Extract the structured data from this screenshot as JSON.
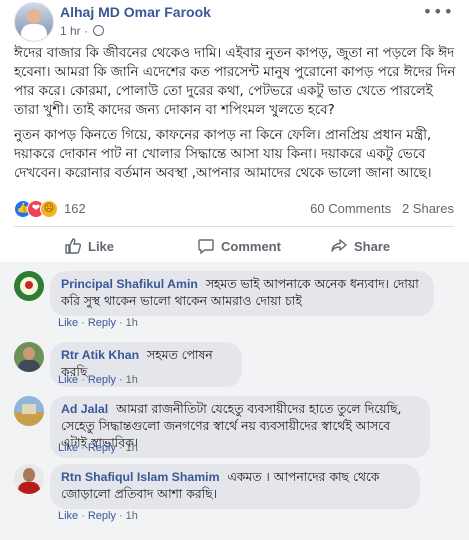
{
  "post": {
    "author": "Alhaj MD Omar Farook",
    "time": "1 hr",
    "paragraphs": [
      "ঈদের বাজার কি জীবনের থেকেও দামি। এইবার নুতন কাপড়, জুতা না পড়লে কি ঈদ হবেনা। আমরা কি জানি এদেশের কত পারসেন্ট মানুষ পুরোনো কাপড় পরে ঈদের দিন পার করে। কোরমা, পোলাউ তো দুরের কথা, পেটভরে একটু ভাত খেতে পারলেই তারা খুশী। তাই কাদের জন্য দোকান বা শপিংমল খুলতে হবে?",
      "নুতন কাপড় কিনতে গিয়ে, কাফনের কাপড় না কিনে ফেলি। প্রানপ্রিয় প্রধান মন্ত্রী, দয়াকরে দোকান পাট না খোলার সিদ্ধান্তে আসা যায় কিনা। দয়াকরে একটু ভেবে দেখবেন। করোনার বর্তমান অবস্থা ,আপনার আমাদের থেকে ভালো জানা আছে।"
    ],
    "reaction_count": "162",
    "comments_count": "60 Comments",
    "shares_count": "2 Shares"
  },
  "actions": {
    "like": "Like",
    "comment": "Comment",
    "share": "Share"
  },
  "comment_actions": {
    "like": "Like",
    "reply": "Reply",
    "dot": "·"
  },
  "comments": [
    {
      "name": "Principal Shafikul Amin",
      "text": "সহমত ভাই আপনাকে অনেক ধন্যবাদ। দোয়া করি সুস্থ থাকেন ভালো থাকেন আমরাও দোয়া চাই",
      "time": "1h"
    },
    {
      "name": "Rtr Atik Khan",
      "text": "সহমত পোষন করছি",
      "time": "1h"
    },
    {
      "name": "Ad Jalal",
      "text": "আমরা রাজনীতিটা যেহেতু ব্যবসায়ীদের হাতে তুলে দিয়েছি, সেহেতু সিদ্ধান্তগুলো জনগণের স্বার্থে নয় ব্যবসায়ীদের স্বার্থেই আসবে এটাই স্বাভাবিক।",
      "time": "1h"
    },
    {
      "name": "Rtn Shafiqul Islam Shamim",
      "text": "একমত । আপনাদের কাছ থেকে জোড়ালো প্রতিবাদ আশা করছি।",
      "time": "1h"
    }
  ],
  "colors": {
    "link": "#385898",
    "like_blue": "#1877f2",
    "love_red": "#f33e58",
    "sad_yellow": "#f7b125"
  }
}
